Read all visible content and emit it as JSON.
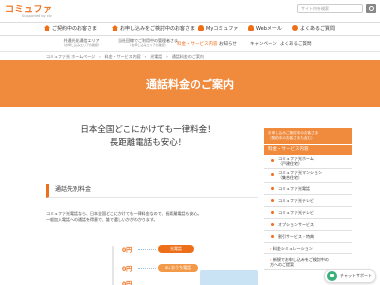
{
  "header": {
    "logo": "コミュファ",
    "logo_tag": "Supported by ctc",
    "search_placeholder": "サイト内を検索"
  },
  "topnav": {
    "customers_label": "ご契約中のお客さま",
    "applying_label": "お申し込みをご検討中のお客さま",
    "mypage_label": "Myコミュファ",
    "webmail_label": "Webメール",
    "faq_label": "よくあるご質問"
  },
  "subrow": {
    "link1": {
      "main": "共通光化通信エリア",
      "sub": "（お申し込みエリアの確認）"
    },
    "link2": {
      "main": "当社回線でご利用中の管理者さま",
      "sub": "（お申し込みエリアの確認）"
    },
    "nav": [
      "料金・サービス内容",
      "お知らせ",
      "キャンペーン",
      "よくあるご質問"
    ]
  },
  "breadcrumb": "コミュファ光 ホームページ　›　料金・サービス内容　›　光電話　›　通話料金のご案内",
  "banner": {
    "title": "通話料金のご案内"
  },
  "hero": {
    "line1": "日本全国どこにかけても一律料金！",
    "line2": "長距離電話も安心！"
  },
  "section": {
    "heading": "通話先別料金",
    "para1": "コミュファ光電話なら、日本全国どこにかけても一律料金なので、長距離電話も安心。",
    "para2": "一般加入電話への通話を得意で、誰で選しいかがわかります。"
  },
  "illustration": {
    "zero": "0円",
    "pill_top": "光電話",
    "pill_mid": "au おうち電話"
  },
  "sidebar": {
    "top_line1": "お申し込みご検討中のお客さま",
    "top_line2": "（契約中のお客さまも含む）",
    "head": "料金・サービス内容",
    "items": [
      {
        "line1": "コミュファ光ホーム",
        "line2": "（戸建住宅）"
      },
      {
        "line1": "コミュファ光マンション",
        "line2": "（集合住宅）"
      },
      {
        "line1": "コミュファ光電話",
        "line2": ""
      },
      {
        "line1": "コミュファ光テレビ",
        "line2": ""
      },
      {
        "line1": "コミュファ光テレビ",
        "line2": ""
      },
      {
        "line1": "オプションサービス",
        "line2": ""
      },
      {
        "line1": "割引サービス・特典",
        "line2": ""
      }
    ],
    "plain1": "料金シミュレーション",
    "plain2_line1": "新規でお申し込みをご検討中の",
    "plain2_line2": "方へのご提案"
  },
  "chat": {
    "label": "チャットサポート"
  },
  "colors": {
    "accent": "#ee6f1a",
    "banner": "#f08a3c",
    "blue": "#9cc3e6"
  }
}
